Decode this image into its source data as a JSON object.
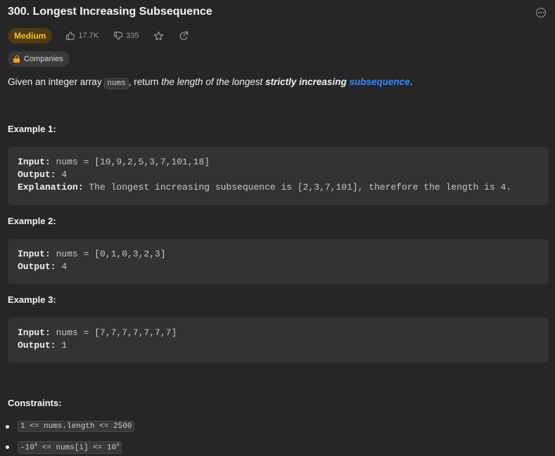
{
  "problem": {
    "title": "300. Longest Increasing Subsequence",
    "difficulty": "Medium",
    "likes": "17.7K",
    "dislikes": "335",
    "companies_label": "Companies"
  },
  "description": {
    "part1": "Given an integer array ",
    "code": "nums",
    "part2": ", return ",
    "italic": "the length of the longest ",
    "strong": "strictly increasing ",
    "link": "subsequence",
    "end": "."
  },
  "examples": [
    {
      "title": "Example 1:",
      "input_label": "Input:",
      "input": " nums = [10,9,2,5,3,7,101,18]",
      "output_label": "Output:",
      "output": " 4",
      "explanation_label": "Explanation:",
      "explanation": " The longest increasing subsequence is [2,3,7,101], therefore the length is 4."
    },
    {
      "title": "Example 2:",
      "input_label": "Input:",
      "input": " nums = [0,1,0,3,2,3]",
      "output_label": "Output:",
      "output": " 4"
    },
    {
      "title": "Example 3:",
      "input_label": "Input:",
      "input": " nums = [7,7,7,7,7,7,7]",
      "output_label": "Output:",
      "output": " 1"
    }
  ],
  "constraints": {
    "title": "Constraints:",
    "c1": "1 <= nums.length <= 2500",
    "c2_a": "-10",
    "c2_exp1": "4",
    "c2_b": " <= nums[i] <= 10",
    "c2_exp2": "4"
  },
  "colors": {
    "background": "#262626",
    "difficulty_medium": "#ffc01e",
    "link": "#3e88f5",
    "lock": "#ffa116"
  },
  "icons": [
    "more-icon",
    "thumbs-up-icon",
    "thumbs-down-icon",
    "star-icon",
    "share-icon",
    "lock-icon"
  ]
}
